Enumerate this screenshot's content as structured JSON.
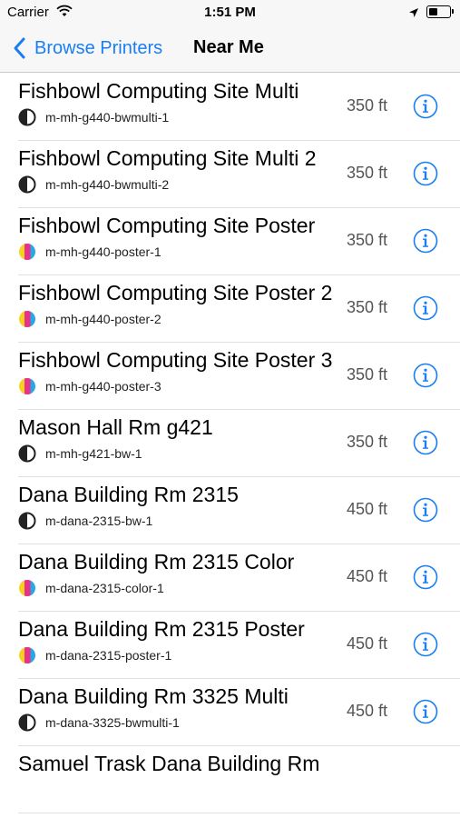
{
  "status_bar": {
    "carrier": "Carrier",
    "time": "1:51 PM",
    "icons": [
      "wifi-icon",
      "location-arrow-icon",
      "battery-icon"
    ]
  },
  "nav": {
    "back_label": "Browse Printers",
    "title": "Near Me"
  },
  "colors": {
    "accent": "#1a7ef2",
    "separator": "#e0e0e4",
    "bw_badge": "#222222",
    "color_badge": [
      "#f5d21f",
      "#e8318b",
      "#2aa7e1"
    ]
  },
  "printers": [
    {
      "name": "Fishbowl Computing Site Multi",
      "queue": "m-mh-g440-bwmulti-1",
      "type": "bw",
      "distance": "350 ft"
    },
    {
      "name": "Fishbowl Computing Site Multi 2",
      "queue": "m-mh-g440-bwmulti-2",
      "type": "bw",
      "distance": "350 ft"
    },
    {
      "name": "Fishbowl Computing Site Poster",
      "queue": "m-mh-g440-poster-1",
      "type": "color",
      "distance": "350 ft"
    },
    {
      "name": "Fishbowl Computing Site Poster 2",
      "queue": "m-mh-g440-poster-2",
      "type": "color",
      "distance": "350 ft"
    },
    {
      "name": "Fishbowl Computing Site Poster 3",
      "queue": "m-mh-g440-poster-3",
      "type": "color",
      "distance": "350 ft"
    },
    {
      "name": "Mason Hall Rm g421",
      "queue": "m-mh-g421-bw-1",
      "type": "bw",
      "distance": "350 ft"
    },
    {
      "name": "Dana Building Rm 2315",
      "queue": "m-dana-2315-bw-1",
      "type": "bw",
      "distance": "450 ft"
    },
    {
      "name": "Dana Building Rm 2315 Color",
      "queue": "m-dana-2315-color-1",
      "type": "color",
      "distance": "450 ft"
    },
    {
      "name": "Dana Building Rm 2315 Poster",
      "queue": "m-dana-2315-poster-1",
      "type": "color",
      "distance": "450 ft"
    },
    {
      "name": "Dana Building Rm 3325 Multi",
      "queue": "m-dana-3325-bwmulti-1",
      "type": "bw",
      "distance": "450 ft"
    },
    {
      "name": "Samuel Trask Dana Building Rm",
      "queue": "",
      "type": "bw",
      "distance": ""
    }
  ]
}
